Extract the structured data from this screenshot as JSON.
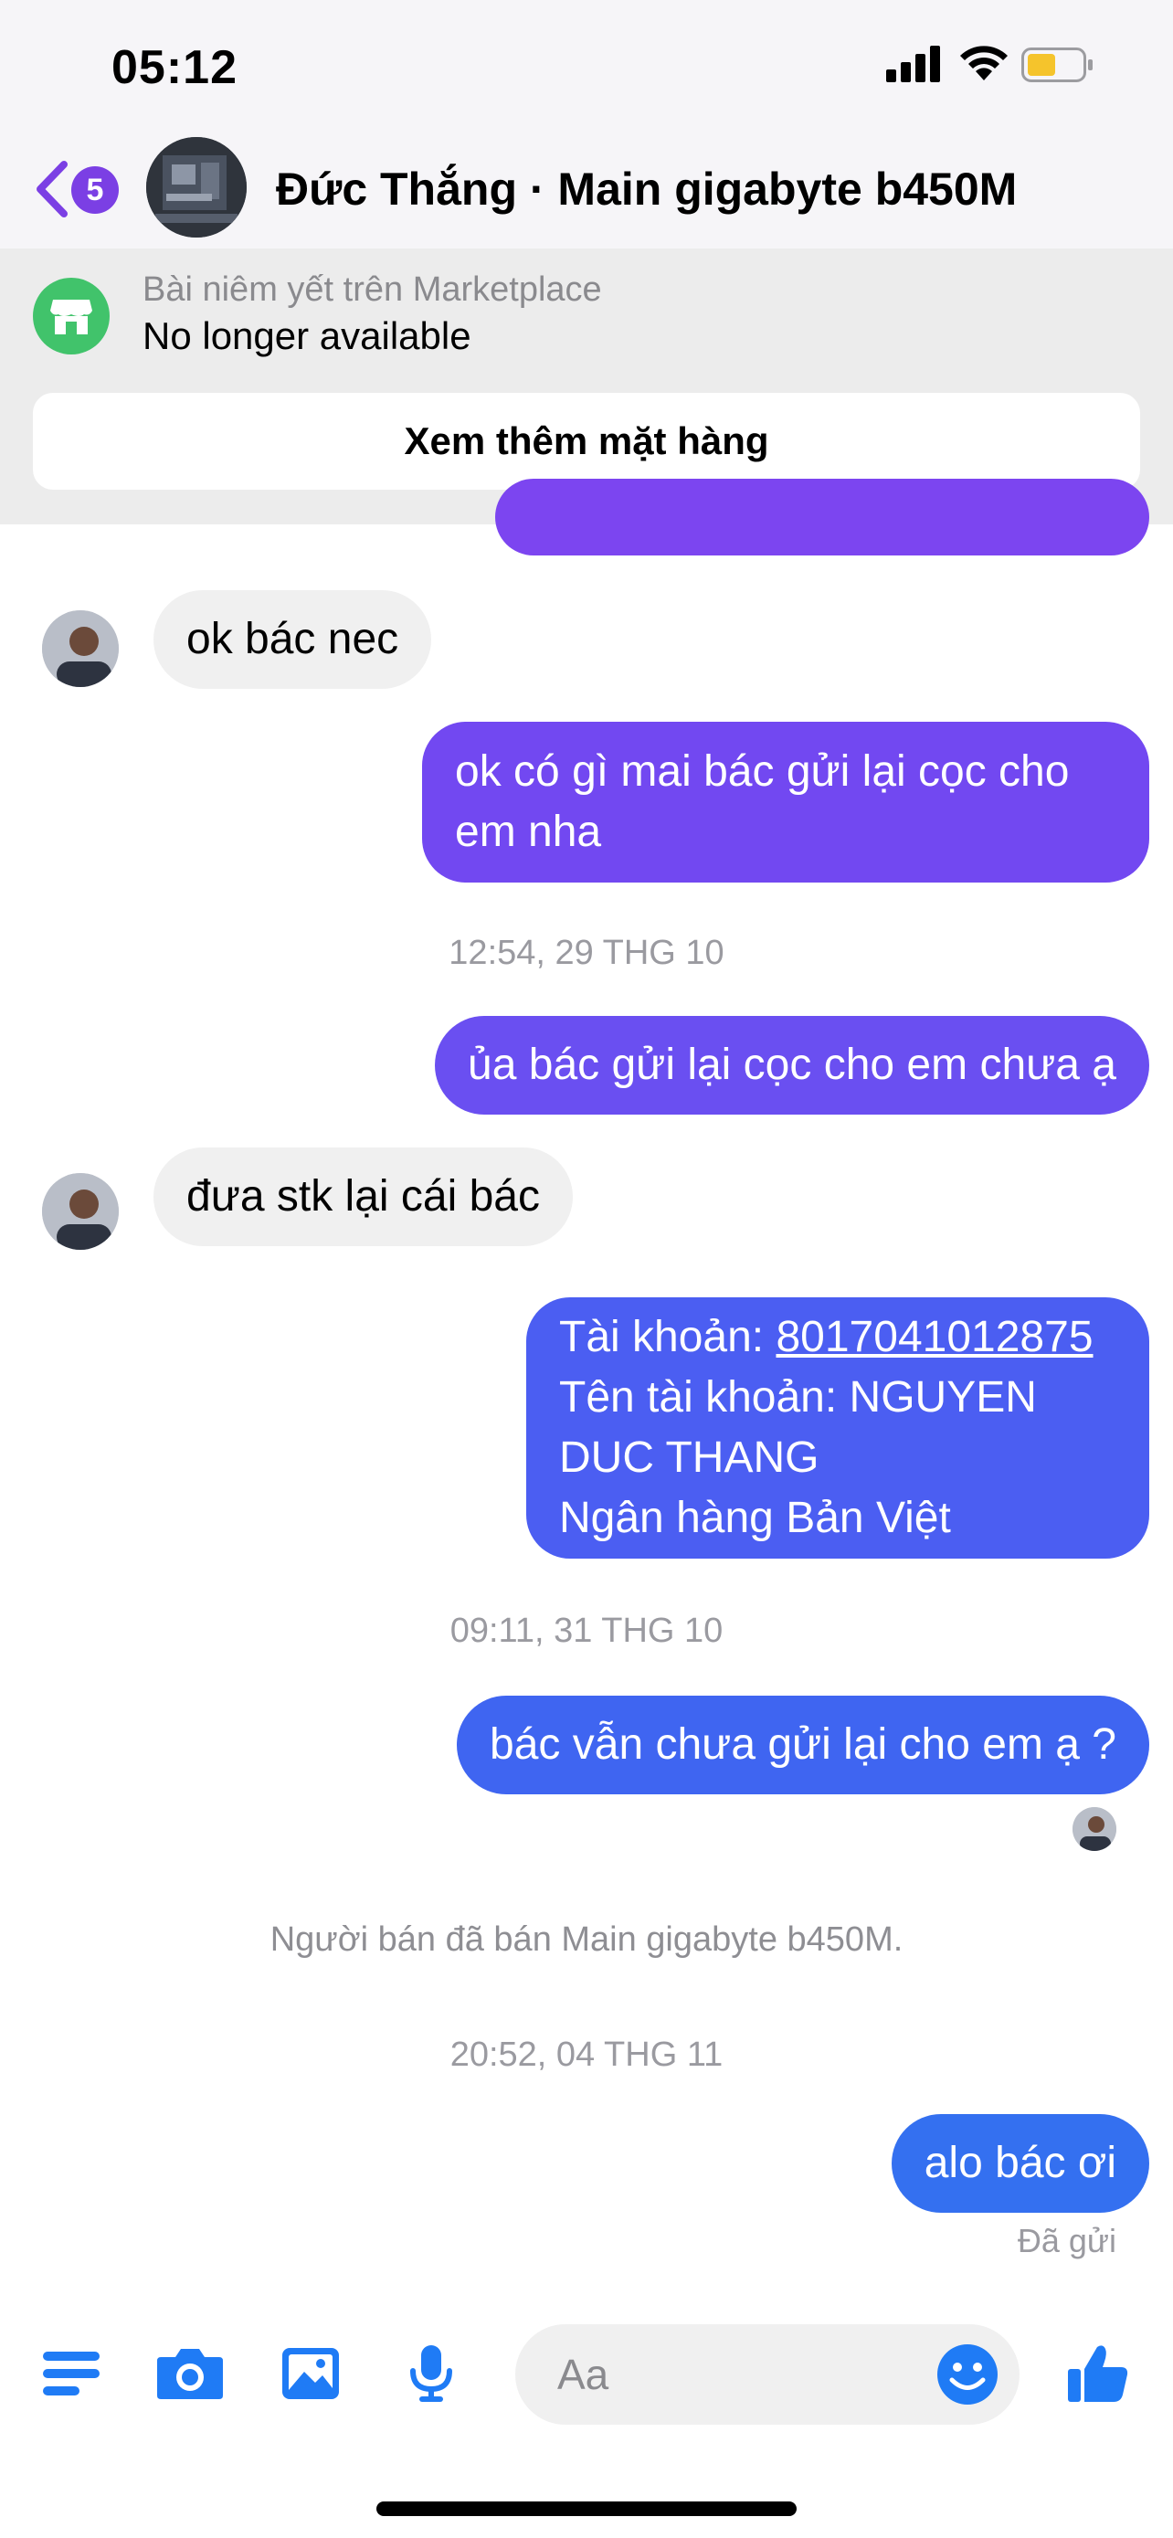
{
  "status_bar": {
    "time": "05:12"
  },
  "header": {
    "back_badge_count": "5",
    "title": "Đức Thắng · Main gigabyte b450M"
  },
  "marketplace": {
    "subtitle": "Bài niêm yết trên Marketplace",
    "status": "No longer available",
    "view_more_label": "Xem thêm mặt hàng"
  },
  "messages": {
    "m1": "ok bác nec",
    "m2": "ok có gì mai bác gửi lại cọc cho em nha",
    "t1": "12:54, 29 THG 10",
    "m3": "ủa bác gửi lại cọc cho em chưa ạ",
    "m4": "đưa stk lại cái bác",
    "m5_line1_label": "Tài khoản: ",
    "m5_account": "8017041012875",
    "m5_line2": "Tên tài khoản: NGUYEN DUC THANG",
    "m5_line3": "Ngân hàng Bản Việt",
    "t2": "09:11, 31 THG 10",
    "m6": "bác vẫn chưa gửi lại cho em ạ ?",
    "system": "Người bán đã bán Main gigabyte b450M.",
    "t3": "20:52, 04 THG 11",
    "m7": "alo bác ơi",
    "sent_status": "Đã gửi"
  },
  "composer": {
    "placeholder": "Aa"
  },
  "colors": {
    "accent_purple": "#7b3fe4",
    "bubble_violet": "#7c45f0",
    "bubble_indigo": "#4b5ef2",
    "bubble_blue": "#3470f0",
    "icon_blue": "#1f7bf5",
    "marketplace_green": "#41c36b"
  }
}
